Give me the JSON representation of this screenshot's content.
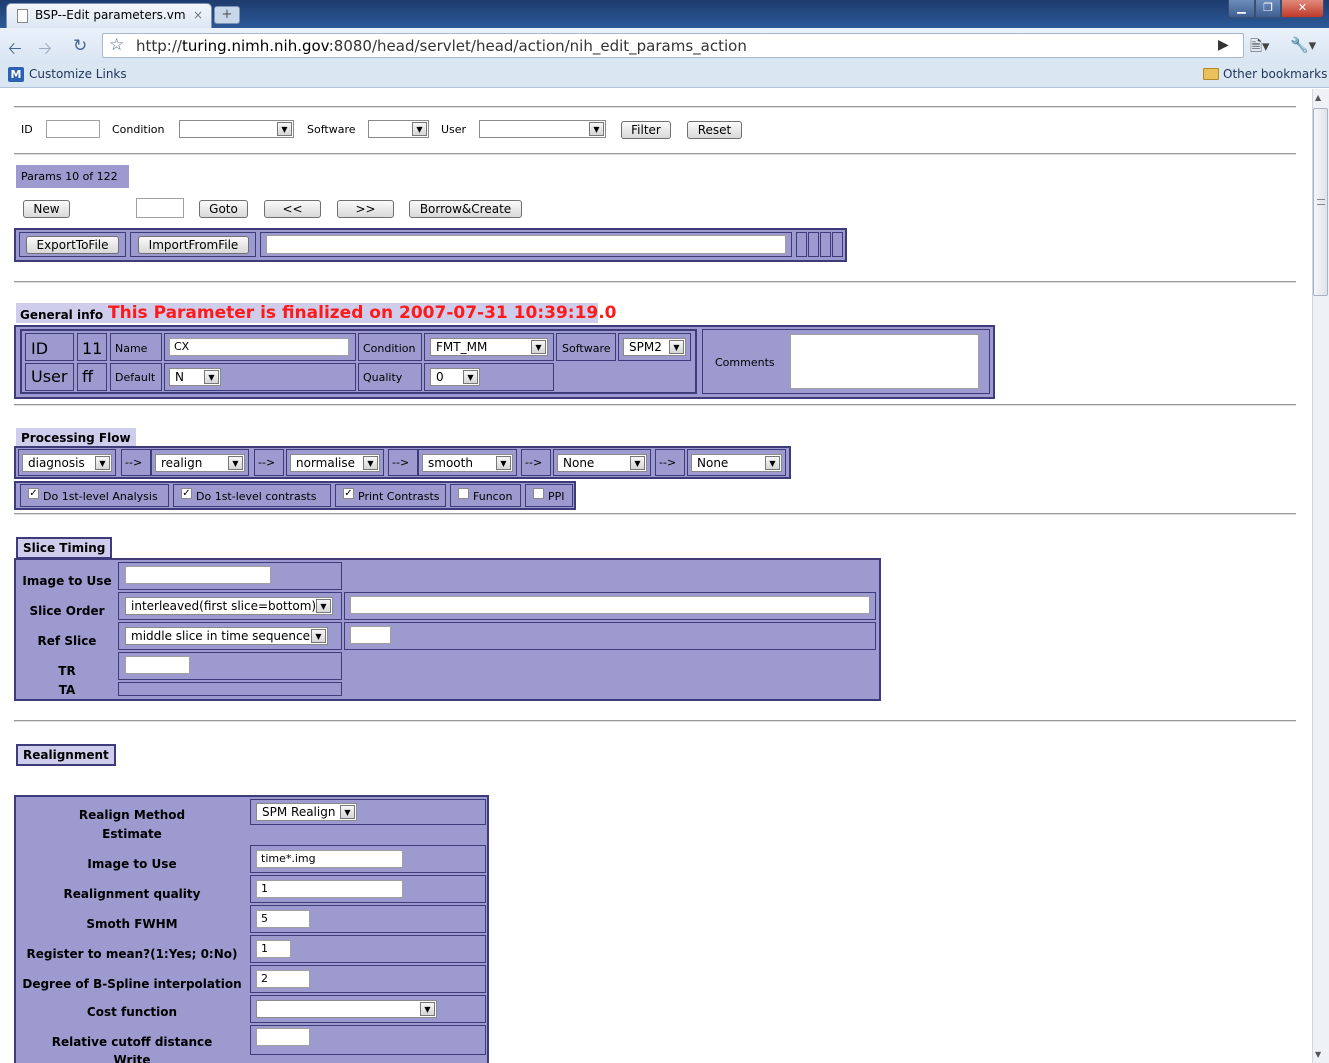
{
  "browser": {
    "tab_title": "BSP--Edit parameters.vm",
    "tab_close": "×",
    "new_tab": "+",
    "url_prefix": "http://",
    "url_domain": "turing.nimh.nih.gov",
    "url_rest": ":8080/head/servlet/head/action/nih_edit_params_action",
    "bookmark_left": "Customize Links",
    "bookmark_right": "Other bookmarks",
    "window_min": "▁",
    "window_max": "❐",
    "window_close": "✕"
  },
  "filter": {
    "id_label": "ID",
    "condition_label": "Condition",
    "software_label": "Software",
    "user_label": "User",
    "filter_btn": "Filter",
    "reset_btn": "Reset"
  },
  "nav": {
    "params_count": "Params 10 of 122",
    "new_btn": "New",
    "goto_btn": "Goto",
    "prev_btn": "<<",
    "next_btn": ">>",
    "borrow_btn": "Borrow&Create",
    "export_btn": "ExportToFile",
    "import_btn": "ImportFromFile"
  },
  "general": {
    "header": "General info",
    "finalized": "This Parameter is finalized on 2007-07-31 10:39:19.0",
    "id_label": "ID",
    "id_value": "11",
    "user_label": "User",
    "user_value": "ff",
    "name_label": "Name",
    "name_value": "CX",
    "default_label": "Default",
    "default_value": "N",
    "condition_label": "Condition",
    "condition_value": "FMT_MM",
    "quality_label": "Quality",
    "quality_value": "0",
    "software_label": "Software",
    "software_value": "SPM2",
    "comments_label": "Comments"
  },
  "flow": {
    "header": "Processing Flow",
    "steps": [
      "diagnosis",
      "realign",
      "normalise",
      "smooth",
      "None",
      "None"
    ],
    "arrow": "-->",
    "checks": [
      {
        "label": "Do 1st-level Analysis",
        "checked": true
      },
      {
        "label": "Do 1st-level contrasts",
        "checked": true
      },
      {
        "label": "Print Contrasts",
        "checked": true
      },
      {
        "label": "Funcon",
        "checked": false
      },
      {
        "label": "PPI",
        "checked": false
      }
    ]
  },
  "slice": {
    "header": "Slice Timing",
    "image_label": "Image to Use",
    "order_label": "Slice Order",
    "order_value": "interleaved(first slice=bottom)",
    "ref_label": "Ref Slice",
    "ref_value": "middle slice in time sequence",
    "tr_label": "TR",
    "ta_label": "TA"
  },
  "realign": {
    "header": "Realignment",
    "method_label": "Realign Method",
    "method_value": "SPM Realign",
    "estimate_label": "Estimate",
    "image_label": "Image to Use",
    "image_value": "time*.img",
    "quality_label": "Realignment quality",
    "quality_value": "1",
    "fwhm_label": "Smoth FWHM",
    "fwhm_value": "5",
    "mean_label": "Register to mean?(1:Yes; 0:No)",
    "mean_value": "1",
    "spline_label": "Degree of B-Spline interpolation",
    "spline_value": "2",
    "cost_label": "Cost function",
    "cutoff_label": "Relative cutoff distance",
    "write_label": "Write"
  }
}
